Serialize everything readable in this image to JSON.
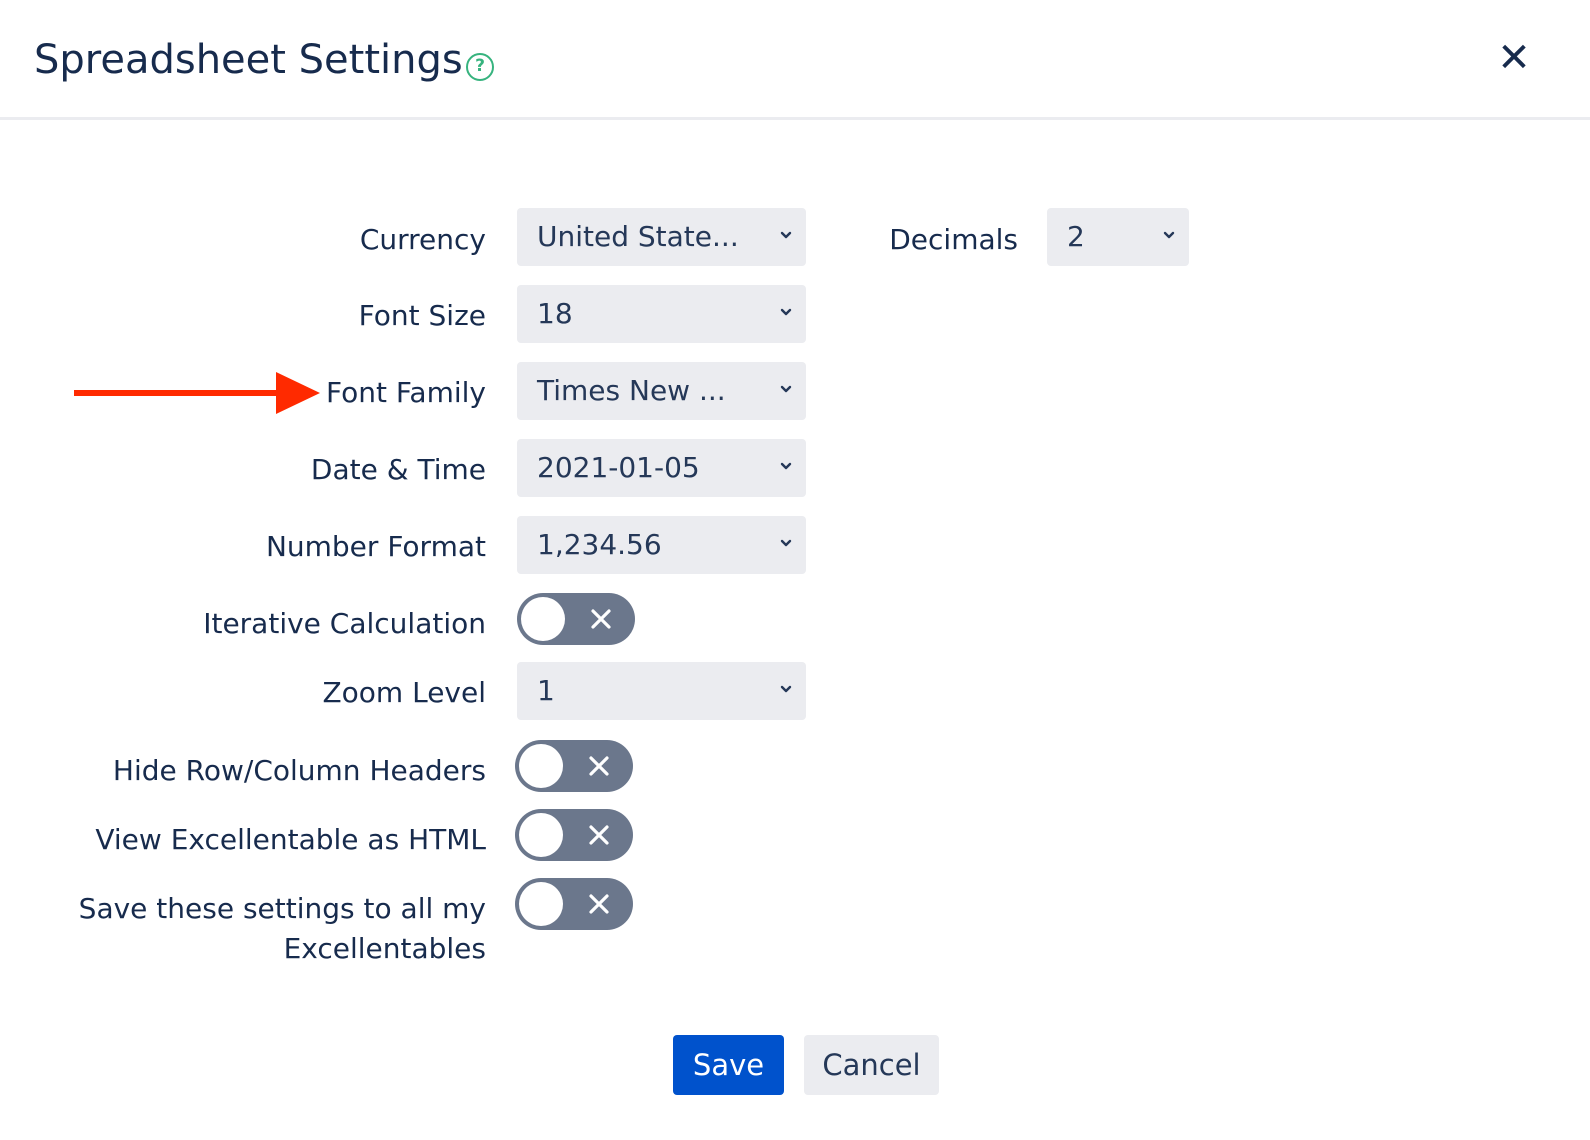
{
  "dialog": {
    "title": "Spreadsheet Settings",
    "help_icon": "question-circle-icon",
    "close_icon": "close-icon",
    "help_glyph": "?",
    "close_glyph": "✕"
  },
  "fields": {
    "currency": {
      "label": "Currency",
      "value": "United State..."
    },
    "decimals": {
      "label": "Decimals",
      "value": "2"
    },
    "font_size": {
      "label": "Font Size",
      "value": "18"
    },
    "font_family": {
      "label": "Font Family",
      "value": "Times New ..."
    },
    "date_time": {
      "label": "Date & Time",
      "value": "2021-01-05"
    },
    "number_format": {
      "label": "Number Format",
      "value": "1,234.56"
    },
    "iterative_calculation": {
      "label": "Iterative Calculation",
      "enabled": false
    },
    "zoom_level": {
      "label": "Zoom Level",
      "value": "1"
    },
    "hide_headers": {
      "label": "Hide Row/Column Headers",
      "enabled": false
    },
    "view_as_html": {
      "label": "View Excellentable as HTML",
      "enabled": false
    },
    "save_to_all": {
      "label": "Save these settings to all my Excellentables",
      "enabled": false
    }
  },
  "footer": {
    "save_label": "Save",
    "cancel_label": "Cancel"
  },
  "colors": {
    "primary": "#0052cc",
    "field_bg": "#ebecf0",
    "toggle_off": "#6b778c",
    "help_green": "#36b37e",
    "annotation_arrow": "#ff2a00",
    "text": "#172b4d"
  }
}
